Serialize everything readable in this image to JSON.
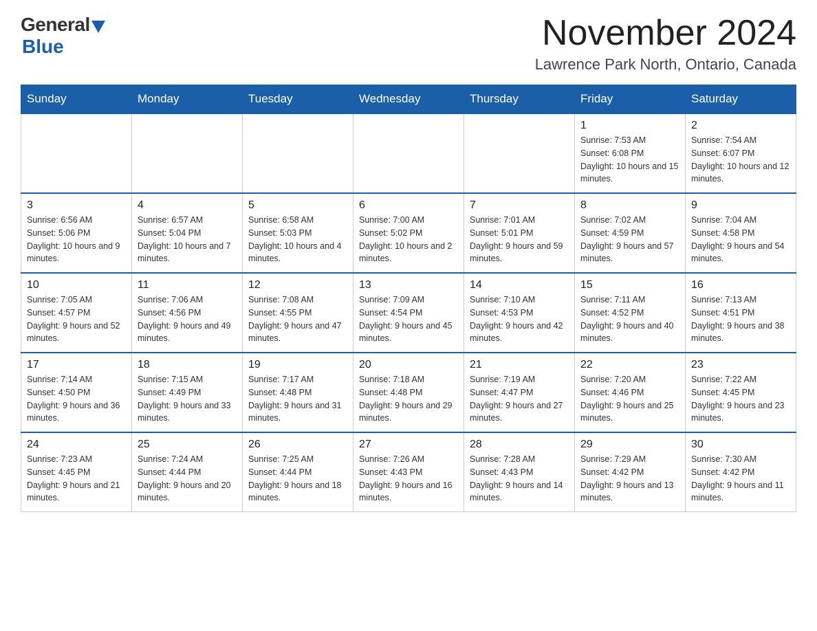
{
  "header": {
    "logo_general": "General",
    "logo_blue": "Blue",
    "month_title": "November 2024",
    "location": "Lawrence Park North, Ontario, Canada"
  },
  "weekdays": [
    "Sunday",
    "Monday",
    "Tuesday",
    "Wednesday",
    "Thursday",
    "Friday",
    "Saturday"
  ],
  "weeks": [
    [
      {
        "day": "",
        "info": ""
      },
      {
        "day": "",
        "info": ""
      },
      {
        "day": "",
        "info": ""
      },
      {
        "day": "",
        "info": ""
      },
      {
        "day": "",
        "info": ""
      },
      {
        "day": "1",
        "info": "Sunrise: 7:53 AM\nSunset: 6:08 PM\nDaylight: 10 hours and 15 minutes."
      },
      {
        "day": "2",
        "info": "Sunrise: 7:54 AM\nSunset: 6:07 PM\nDaylight: 10 hours and 12 minutes."
      }
    ],
    [
      {
        "day": "3",
        "info": "Sunrise: 6:56 AM\nSunset: 5:06 PM\nDaylight: 10 hours and 9 minutes."
      },
      {
        "day": "4",
        "info": "Sunrise: 6:57 AM\nSunset: 5:04 PM\nDaylight: 10 hours and 7 minutes."
      },
      {
        "day": "5",
        "info": "Sunrise: 6:58 AM\nSunset: 5:03 PM\nDaylight: 10 hours and 4 minutes."
      },
      {
        "day": "6",
        "info": "Sunrise: 7:00 AM\nSunset: 5:02 PM\nDaylight: 10 hours and 2 minutes."
      },
      {
        "day": "7",
        "info": "Sunrise: 7:01 AM\nSunset: 5:01 PM\nDaylight: 9 hours and 59 minutes."
      },
      {
        "day": "8",
        "info": "Sunrise: 7:02 AM\nSunset: 4:59 PM\nDaylight: 9 hours and 57 minutes."
      },
      {
        "day": "9",
        "info": "Sunrise: 7:04 AM\nSunset: 4:58 PM\nDaylight: 9 hours and 54 minutes."
      }
    ],
    [
      {
        "day": "10",
        "info": "Sunrise: 7:05 AM\nSunset: 4:57 PM\nDaylight: 9 hours and 52 minutes."
      },
      {
        "day": "11",
        "info": "Sunrise: 7:06 AM\nSunset: 4:56 PM\nDaylight: 9 hours and 49 minutes."
      },
      {
        "day": "12",
        "info": "Sunrise: 7:08 AM\nSunset: 4:55 PM\nDaylight: 9 hours and 47 minutes."
      },
      {
        "day": "13",
        "info": "Sunrise: 7:09 AM\nSunset: 4:54 PM\nDaylight: 9 hours and 45 minutes."
      },
      {
        "day": "14",
        "info": "Sunrise: 7:10 AM\nSunset: 4:53 PM\nDaylight: 9 hours and 42 minutes."
      },
      {
        "day": "15",
        "info": "Sunrise: 7:11 AM\nSunset: 4:52 PM\nDaylight: 9 hours and 40 minutes."
      },
      {
        "day": "16",
        "info": "Sunrise: 7:13 AM\nSunset: 4:51 PM\nDaylight: 9 hours and 38 minutes."
      }
    ],
    [
      {
        "day": "17",
        "info": "Sunrise: 7:14 AM\nSunset: 4:50 PM\nDaylight: 9 hours and 36 minutes."
      },
      {
        "day": "18",
        "info": "Sunrise: 7:15 AM\nSunset: 4:49 PM\nDaylight: 9 hours and 33 minutes."
      },
      {
        "day": "19",
        "info": "Sunrise: 7:17 AM\nSunset: 4:48 PM\nDaylight: 9 hours and 31 minutes."
      },
      {
        "day": "20",
        "info": "Sunrise: 7:18 AM\nSunset: 4:48 PM\nDaylight: 9 hours and 29 minutes."
      },
      {
        "day": "21",
        "info": "Sunrise: 7:19 AM\nSunset: 4:47 PM\nDaylight: 9 hours and 27 minutes."
      },
      {
        "day": "22",
        "info": "Sunrise: 7:20 AM\nSunset: 4:46 PM\nDaylight: 9 hours and 25 minutes."
      },
      {
        "day": "23",
        "info": "Sunrise: 7:22 AM\nSunset: 4:45 PM\nDaylight: 9 hours and 23 minutes."
      }
    ],
    [
      {
        "day": "24",
        "info": "Sunrise: 7:23 AM\nSunset: 4:45 PM\nDaylight: 9 hours and 21 minutes."
      },
      {
        "day": "25",
        "info": "Sunrise: 7:24 AM\nSunset: 4:44 PM\nDaylight: 9 hours and 20 minutes."
      },
      {
        "day": "26",
        "info": "Sunrise: 7:25 AM\nSunset: 4:44 PM\nDaylight: 9 hours and 18 minutes."
      },
      {
        "day": "27",
        "info": "Sunrise: 7:26 AM\nSunset: 4:43 PM\nDaylight: 9 hours and 16 minutes."
      },
      {
        "day": "28",
        "info": "Sunrise: 7:28 AM\nSunset: 4:43 PM\nDaylight: 9 hours and 14 minutes."
      },
      {
        "day": "29",
        "info": "Sunrise: 7:29 AM\nSunset: 4:42 PM\nDaylight: 9 hours and 13 minutes."
      },
      {
        "day": "30",
        "info": "Sunrise: 7:30 AM\nSunset: 4:42 PM\nDaylight: 9 hours and 11 minutes."
      }
    ]
  ]
}
